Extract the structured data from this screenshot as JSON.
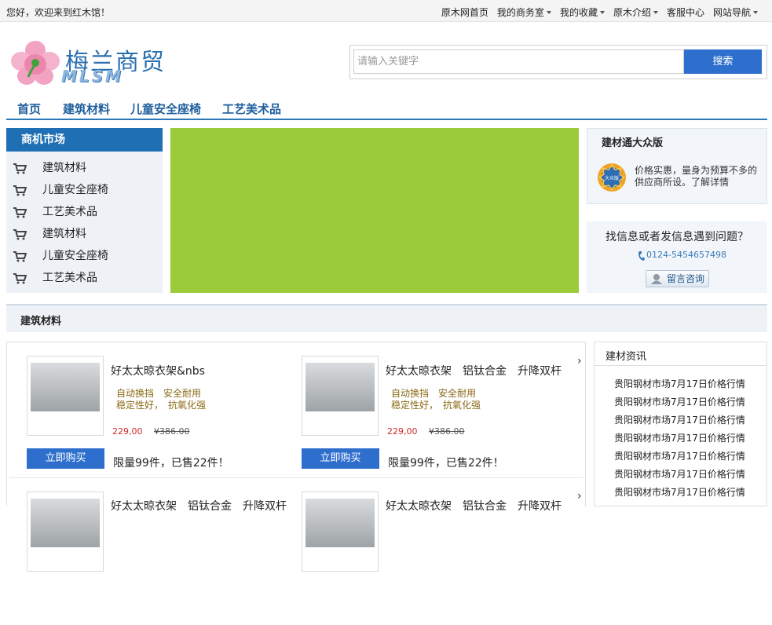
{
  "topbar": {
    "welcome": "您好，欢迎来到红木馆！",
    "links": [
      {
        "label": "原木网首页",
        "dropdown": false
      },
      {
        "label": "我的商务室",
        "dropdown": true
      },
      {
        "label": "我的收藏",
        "dropdown": true
      },
      {
        "label": "原木介绍",
        "dropdown": true
      },
      {
        "label": "客服中心",
        "dropdown": false
      },
      {
        "label": "网站导航",
        "dropdown": true
      }
    ]
  },
  "logo": {
    "name": "梅兰商贸",
    "abbr": "MLSM"
  },
  "search": {
    "placeholder": "请输入关键字",
    "button": "搜索"
  },
  "nav": [
    "首页",
    "建筑材料",
    "儿童安全座椅",
    "工艺美术品"
  ],
  "category": {
    "title": "商机市场",
    "items": [
      "建筑材料",
      "儿童安全座椅",
      "工艺美术品",
      "建筑材料",
      "儿童安全座椅",
      "工艺美术品"
    ]
  },
  "promo": {
    "title": "建材通大众版",
    "badge_text": "大众版",
    "desc": "价格实惠，量身为预算不多的供应商所设。了解详情"
  },
  "help": {
    "question": "找信息或者发信息遇到问题？",
    "phone": "0124-5454657498",
    "button": "留言咨询"
  },
  "section": {
    "title": "建筑材料"
  },
  "products": [
    {
      "name": "好太太晾衣架&nbs",
      "feature1": "自动换挡　安全耐用",
      "feature2": "稳定性好，　抗氧化强",
      "price": "229,00",
      "orig_price": "¥386.00",
      "buy": "立即购买",
      "limit": "限量99件，已售22件！"
    },
    {
      "name": "好太太晾衣架　铝钛合金　升降双杆",
      "feature1": "自动换挡　安全耐用",
      "feature2": "稳定性好，　抗氧化强",
      "price": "229,00",
      "orig_price": "¥386.00",
      "buy": "立即购买",
      "limit": "限量99件，已售22件！"
    },
    {
      "name": "好太太晾衣架　铝钛合金　升降双杆"
    },
    {
      "name": "好太太晾衣架　铝钛合金　升降双杆"
    }
  ],
  "news": {
    "title": "建材资讯",
    "items": [
      "贵阳钢材市场7月17日价格行情",
      "贵阳钢材市场7月17日价格行情",
      "贵阳钢材市场7月17日价格行情",
      "贵阳钢材市场7月17日价格行情",
      "贵阳钢材市场7月17日价格行情",
      "贵阳钢材市场7月17日价格行情",
      "贵阳钢材市场7月17日价格行情"
    ]
  },
  "colors": {
    "accent": "#2e6fcd",
    "nav_text": "#1f5f9e",
    "banner": "#9ccb3a",
    "price": "#d12b2b"
  }
}
